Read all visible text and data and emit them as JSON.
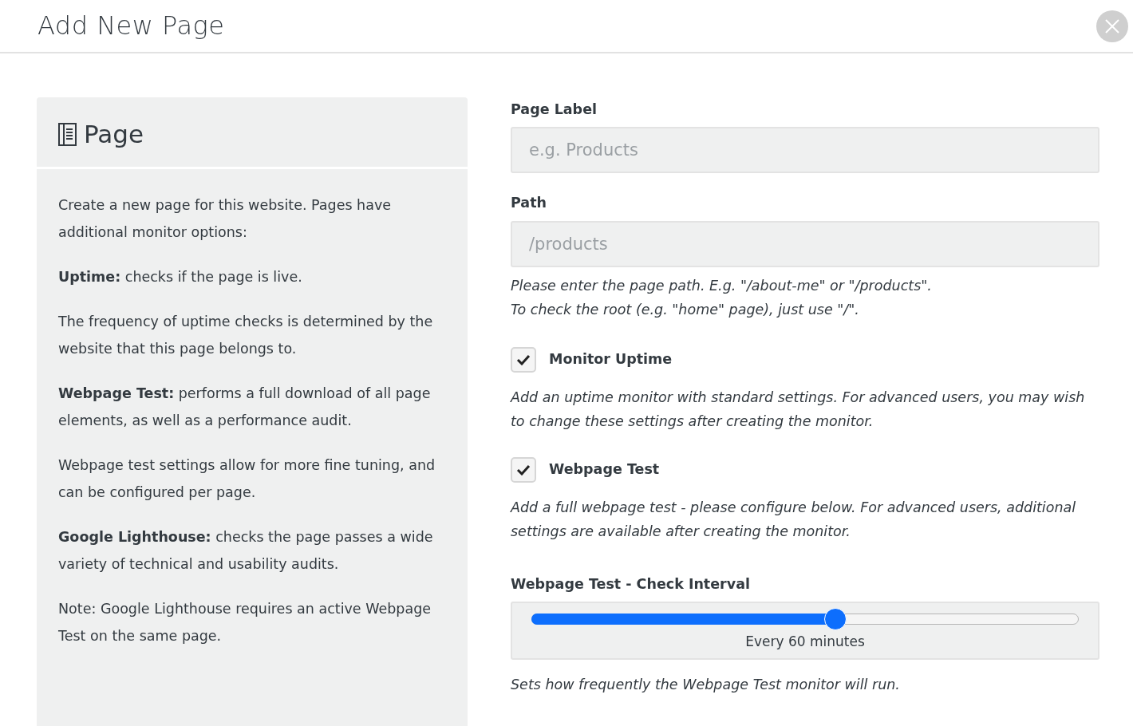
{
  "modal": {
    "title": "Add New Page"
  },
  "info_panel": {
    "heading": "Page",
    "paragraphs": [
      "Create a new page for this website. Pages have additional monitor options:",
      "**Uptime:** checks if the page is live.",
      "The frequency of uptime checks is determined by the website that this page belongs to.",
      "**Webpage Test:** performs a full download of all page elements, as well as a performance audit.",
      "Webpage test settings allow for more fine tuning, and can be configured per page.",
      "**Google Lighthouse:** checks the page passes a wide variety of technical and usability audits.",
      "Note: Google Lighthouse requires an active Webpage Test on the same page."
    ]
  },
  "fields": [
    {
      "label": "Page Label",
      "placeholder": "e.g. Products"
    },
    {
      "label": "Path",
      "placeholder": "/products",
      "help": [
        "Please enter the page path. E.g. \"/about-me\" or \"/products\".",
        "To check the root (e.g. \"home\" page), just use \"/\"."
      ]
    }
  ],
  "checks": [
    {
      "label": "Monitor Uptime",
      "checked": true,
      "help": "Add an uptime monitor with standard settings. For advanced users, you may wish to change these settings after creating the monitor."
    },
    {
      "label": "Webpage Test",
      "checked": true,
      "help": "Add a full webpage test - please configure below. For advanced users, additional settings are available after creating the monitor."
    }
  ],
  "interval": {
    "label": "Webpage Test - Check Interval",
    "level": 0.555,
    "reading": "Every 60 minutes",
    "help": "Sets how frequently the Webpage Test monitor will run."
  }
}
